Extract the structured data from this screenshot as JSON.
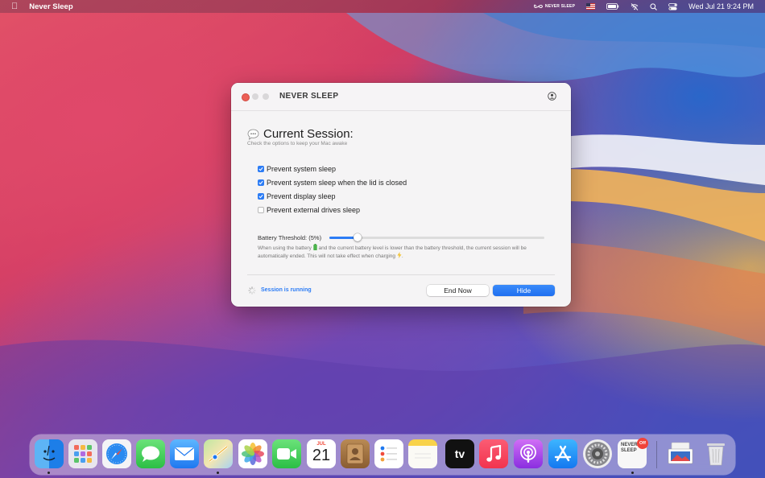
{
  "menubar": {
    "apple": "",
    "app_name": "Never Sleep",
    "never_sleep_status": "NEVER SLEEP",
    "datetime": "Wed Jul 21  9:24 PM"
  },
  "window": {
    "title": "NEVER SLEEP",
    "session_title": "Current Session:",
    "session_subtitle": "Check the options to keep your Mac awake",
    "options": [
      {
        "label": "Prevent system sleep",
        "checked": true
      },
      {
        "label": "Prevent system sleep when the lid is closed",
        "checked": true
      },
      {
        "label": "Prevent display sleep",
        "checked": true
      },
      {
        "label": "Prevent external drives sleep",
        "checked": false
      }
    ],
    "battery_threshold_label": "Battery Threshold: (5%)",
    "battery_threshold_value": 0.05,
    "battery_desc_1": "When using the battery",
    "battery_desc_2": " and the current battery level is lower than the battery threshold, the current session will be automatically ended. This will not take effect when charging",
    "battery_desc_3": ".",
    "status_text": "Session is running",
    "end_button": "End Now",
    "hide_button": "Hide"
  },
  "dock": {
    "calendar_month": "JUL",
    "calendar_day": "21",
    "apple_tv_label": "tv",
    "never_sleep_icon_text": "NEVER SLEEP",
    "badge_text": "Off",
    "colors": {
      "accent": "#2c7cf5",
      "close_red": "#ec5f56"
    }
  }
}
